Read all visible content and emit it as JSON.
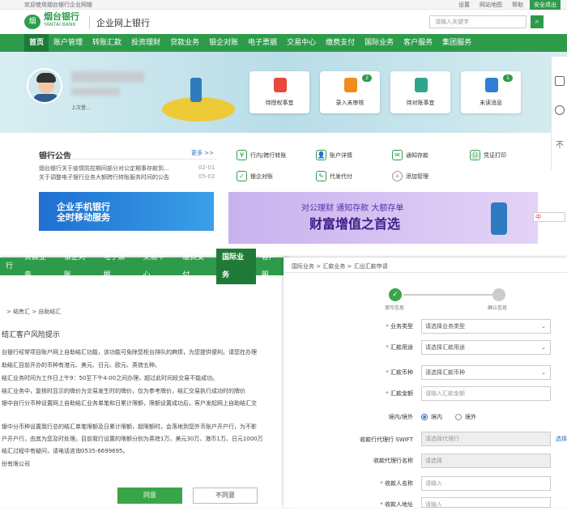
{
  "topbar": {
    "welcome": "欢迎使用烟台银行企业网银",
    "links": [
      "设置",
      "网站地图",
      "帮助"
    ],
    "logout": "安全退出"
  },
  "header": {
    "logo_glyph": "烟",
    "bank_name": "烟台银行",
    "bank_name_en": "YANTAI BANK",
    "product": "企业网上银行",
    "search_placeholder": "请输入关键字"
  },
  "nav": {
    "home": "首页",
    "items": [
      "账户管理",
      "转账汇款",
      "投资理财",
      "贷款业务",
      "银企对账",
      "电子票据",
      "交易中心",
      "缴费支付",
      "国际业务",
      "客户服务",
      "集团服务"
    ]
  },
  "user": {
    "last_login": "上次登..."
  },
  "quick_cards": [
    {
      "label": "待授权事宜",
      "badge": "",
      "color": "#e8493b"
    },
    {
      "label": "录入未审核",
      "badge": "2",
      "color": "#f08c1e"
    },
    {
      "label": "待对账事宜",
      "badge": "",
      "color": "#2ea58c"
    },
    {
      "label": "未读消息",
      "badge": "1",
      "color": "#2e7fd6"
    }
  ],
  "notices": {
    "title": "银行公告",
    "more": "更多 >>",
    "items": [
      {
        "text": "烟台银行关于疫情防控期间部分对公定期事存款到...",
        "date": "02-01"
      },
      {
        "text": "关于调整电子银行业务大额跨行转账服务时间的公告",
        "date": "05-02"
      }
    ]
  },
  "quick_links": [
    {
      "label": "行内/跨行转账",
      "icon": "¥"
    },
    {
      "label": "账户详情",
      "icon": "👤"
    },
    {
      "label": "通知存款",
      "icon": "✉"
    },
    {
      "label": "凭证打印",
      "icon": "🖨"
    },
    {
      "label": "银企对账",
      "icon": "✓"
    },
    {
      "label": "代发代付",
      "icon": "✎"
    },
    {
      "label": "添加管理",
      "icon": "+"
    }
  ],
  "promos": {
    "mobile_line1": "企业手机银行",
    "mobile_line2": "全时移动服务",
    "wealth_line1": "对公理财  通知存款  大额存单",
    "wealth_line2": "财富增值之首选"
  },
  "ime_label": "中",
  "panel2": {
    "nav": [
      "行",
      "贷款业务",
      "银企对账",
      "电子票据",
      "交易中心",
      "缴费支付",
      "国际业务",
      "客户服"
    ],
    "breadcrumb": "> 结售汇 > 自助结汇",
    "heading": "结汇客户风险提示",
    "paragraphs": [
      "台银行经常项目账户网上自助结汇功能，该功能可免除您柜台排队的麻烦，为您提供便利。请您在办理",
      "助结汇目前开办的币种有港元、美元、日元、欧元、英镑五种。",
      "结汇业务时间为工作日上午9：50至下午4:00之间办理，超过此时间段交易不能成功。",
      "结汇业务中，复核时显示的牌价为交易发生时的牌价，仅为参考牌价，结汇交易执行成功时的牌价",
      "银中自行分币种设置网上自助结汇业务单笔和日累计限额，限额设置成功后，客户发起网上自助结汇交",
      "银中分币种设置我行总的结汇单笔限额及日累计限额，超限额时，会落地到您外币账户开户行，为不影",
      "户开户行，由其为您及时处理。目前我行设置的限额分别为英镑1万、美元30万、港币1万、日元1000万",
      "结汇过程中有疑问，请电话咨询0535-6699695。",
      "份有限公司"
    ],
    "agree": "同意",
    "disagree": "不同意"
  },
  "panel3": {
    "breadcrumb": "国际业务 > 汇款业务 > 汇出汇款申请",
    "steps": [
      "填写信息",
      "确认信息"
    ],
    "fields": [
      {
        "label": "业务类型",
        "required": true,
        "type": "select",
        "value": "请选择业务类型"
      },
      {
        "label": "汇款用途",
        "required": true,
        "type": "select",
        "value": "请选择汇款用途"
      },
      {
        "label": "汇款币种",
        "required": true,
        "type": "select",
        "value": "请选择汇款币种"
      },
      {
        "label": "汇款金额",
        "required": true,
        "type": "input",
        "value": "请输入汇款金额"
      }
    ],
    "domestic_label": "境内/境外",
    "domestic_options": [
      "境内",
      "境外"
    ],
    "swift_label": "收款行代理行 SWIFT",
    "swift_value": "请选择代理行",
    "swift_link": "选择",
    "bank_name_label": "收款代理行名称",
    "bank_name_value": "请选择",
    "payee_name_label": "收款人名称",
    "payee_name_value": "请输入",
    "payee_addr_label": "收款人地址",
    "payee_addr_value": "请输入"
  }
}
